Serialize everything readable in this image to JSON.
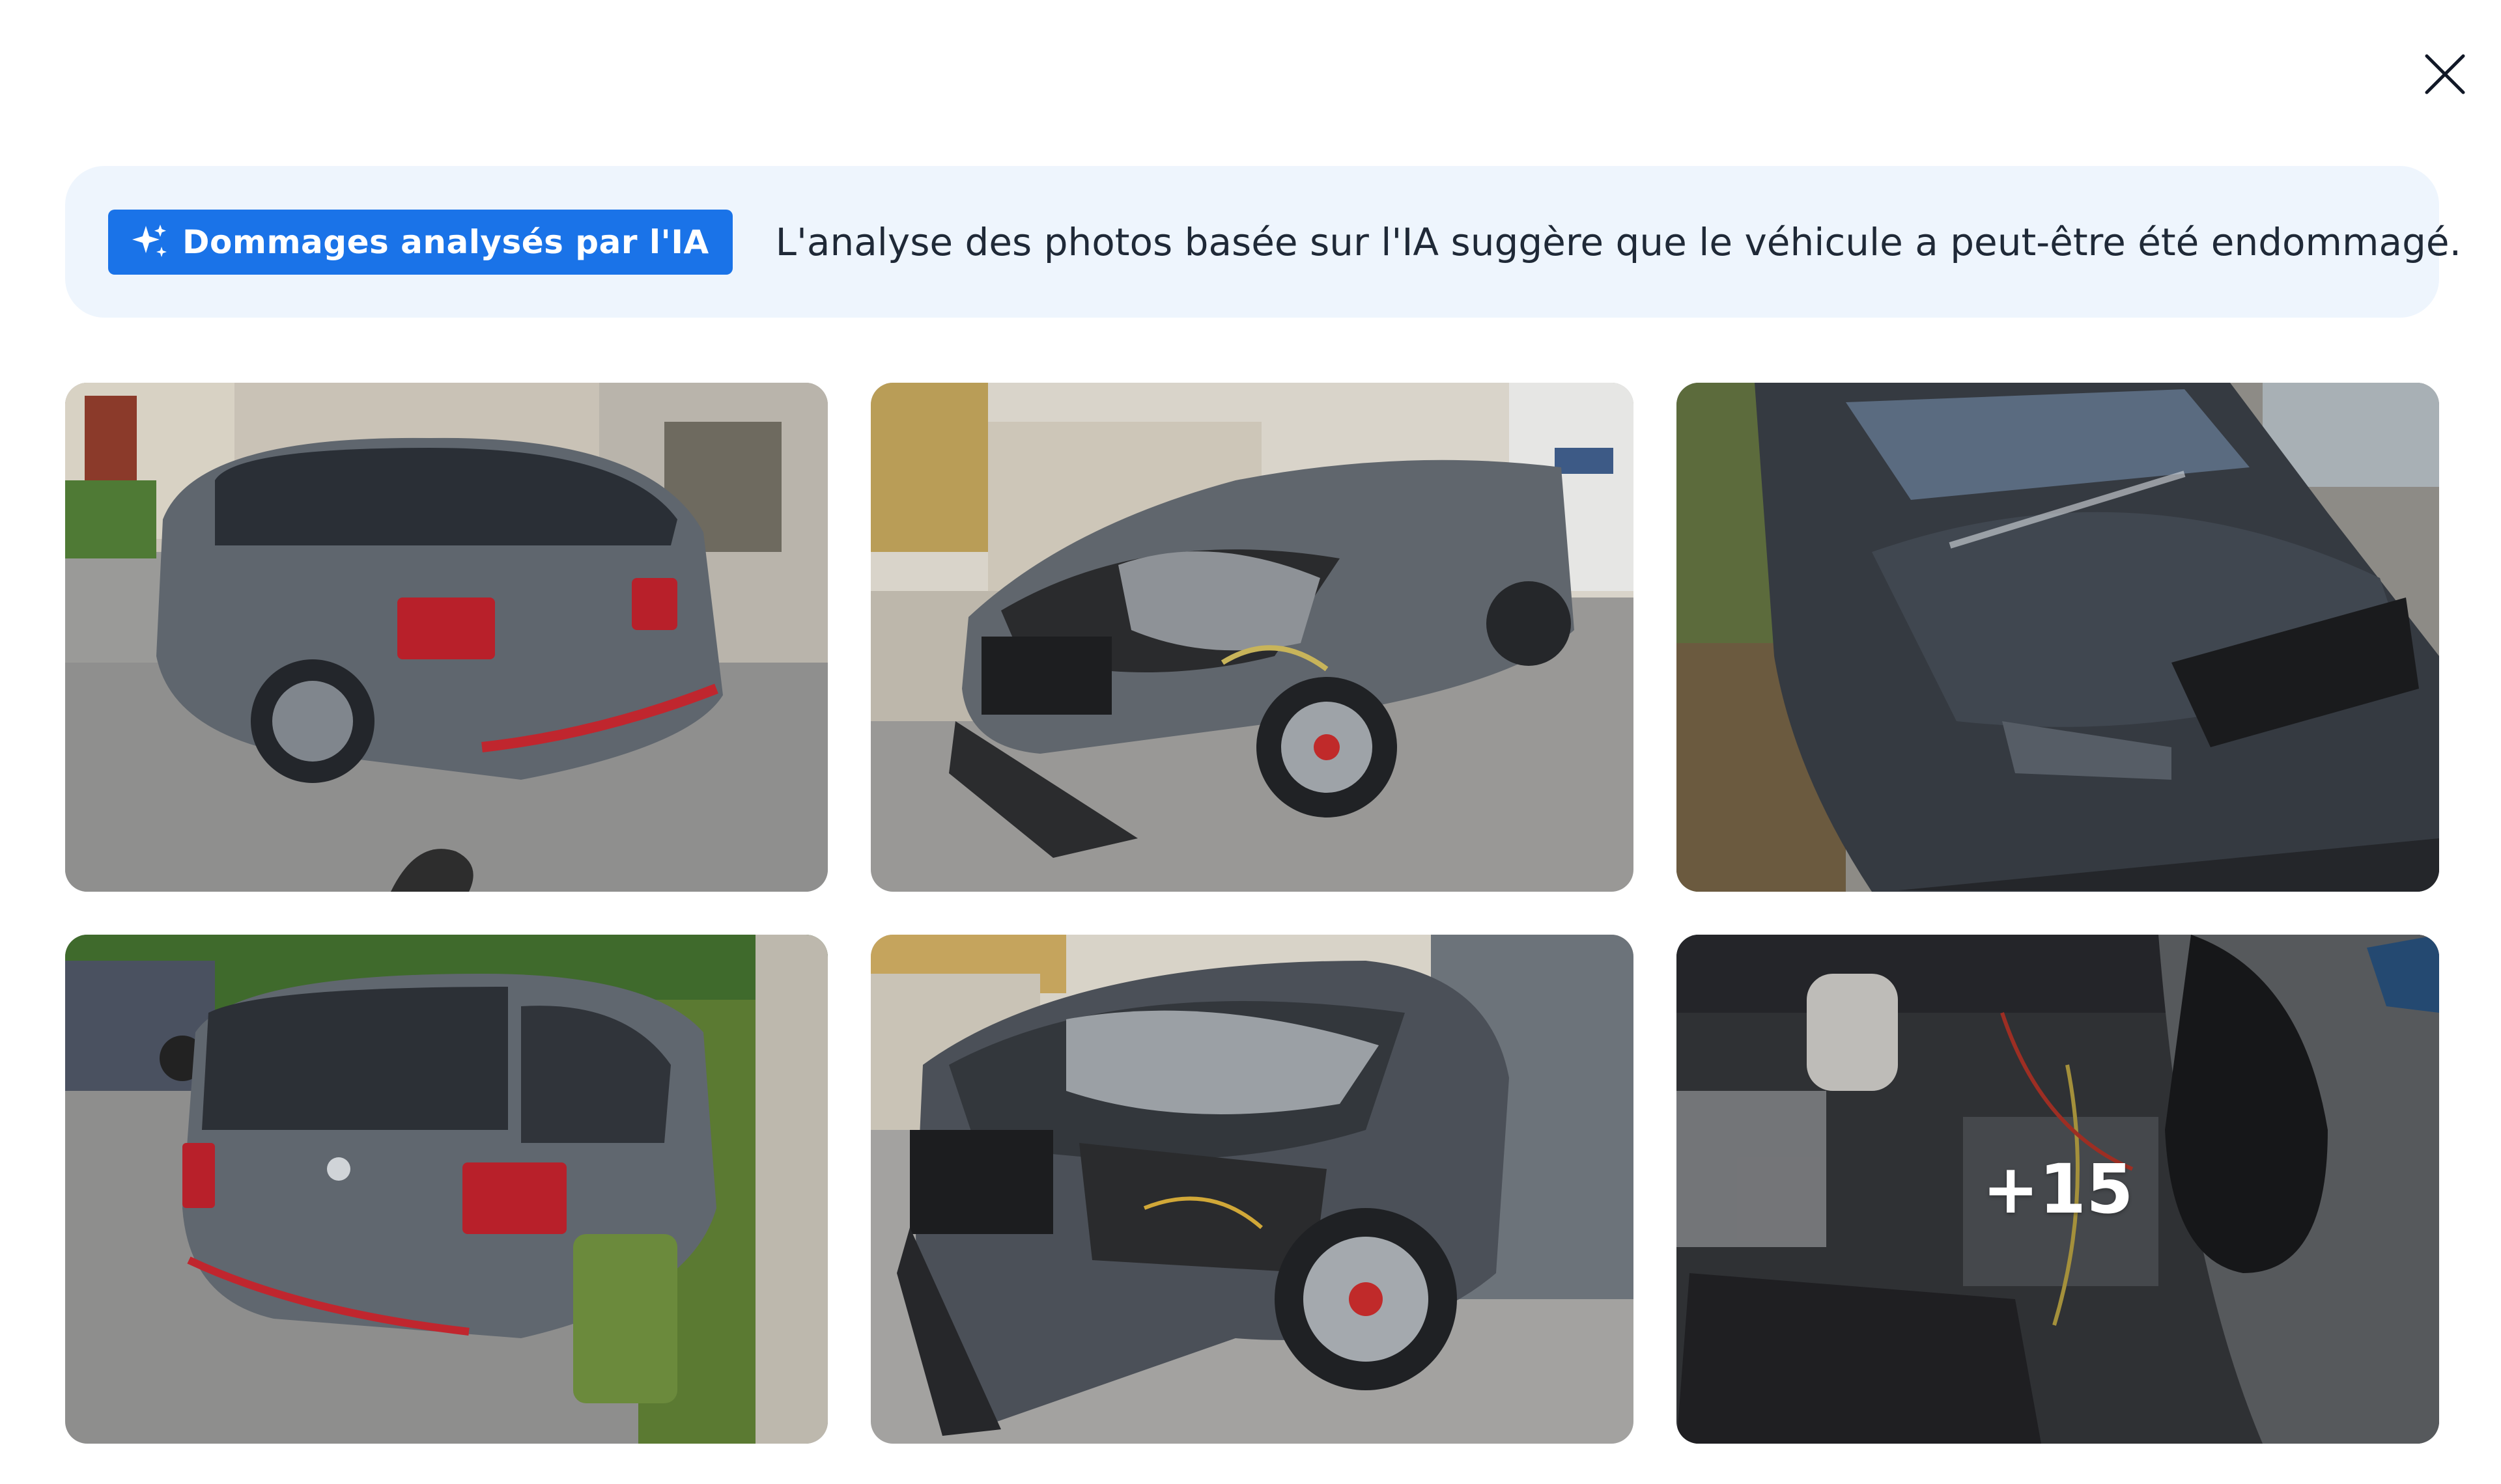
{
  "modal": {
    "close_icon": "close-icon"
  },
  "ai_banner": {
    "badge_label": "Dommages analysés par l'IA",
    "badge_icon": "sparkle-icon",
    "message": "L'analyse des photos basée sur l'IA suggère que le véhicule a peut-être été endommagé.",
    "badge_color": "#1a73e8",
    "background_color": "#eef5fd"
  },
  "gallery": {
    "more_count_label": "+15"
  }
}
